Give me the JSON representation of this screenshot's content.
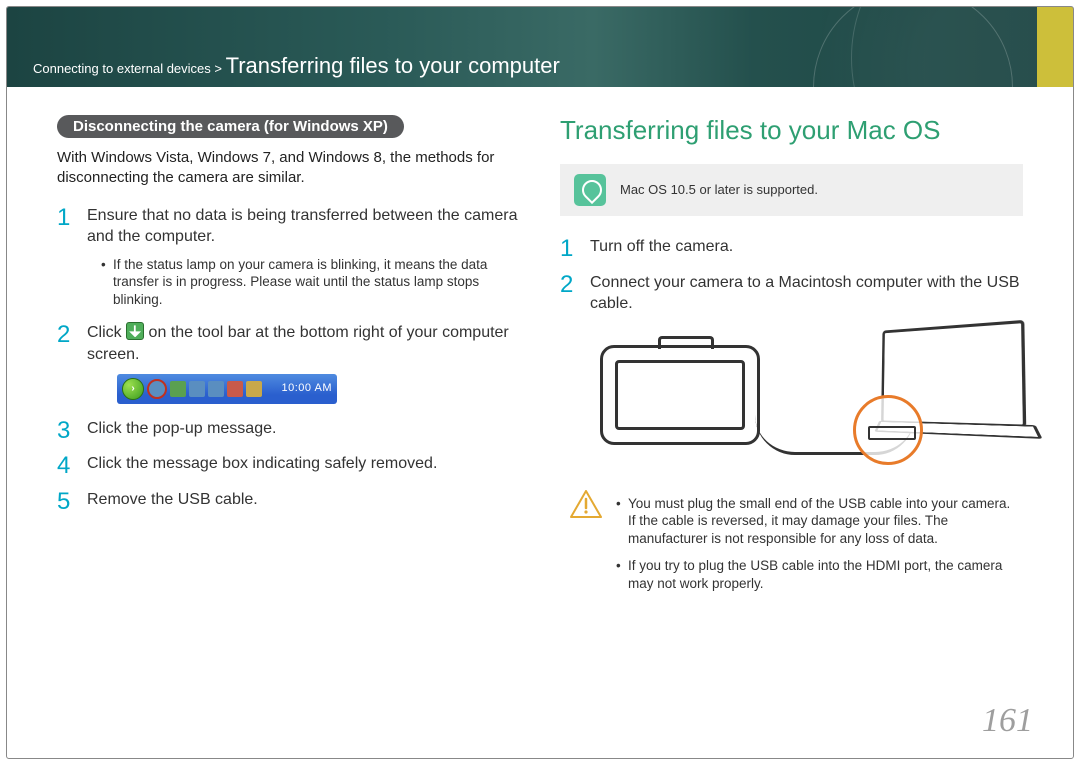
{
  "header": {
    "breadcrumb_prefix": "Connecting to external devices >",
    "breadcrumb_title": "Transferring files to your computer"
  },
  "left": {
    "pill": "Disconnecting the camera (for Windows XP)",
    "intro": "With Windows Vista, Windows 7, and Windows 8, the methods for disconnecting the camera are similar.",
    "steps": [
      {
        "text": "Ensure that no data is being transferred between the camera and the computer.",
        "sub": "If the status lamp on your camera is blinking, it means the data transfer is in progress. Please wait until the status lamp stops blinking."
      },
      {
        "text_before": "Click ",
        "text_after": " on the tool bar at the bottom right of your computer screen.",
        "taskbar_time": "10:00 AM"
      },
      {
        "text": "Click the pop-up message."
      },
      {
        "text": "Click the message box indicating safely removed."
      },
      {
        "text": "Remove the USB cable."
      }
    ]
  },
  "right": {
    "title": "Transferring files to your Mac OS",
    "note": "Mac OS 10.5 or later is supported.",
    "steps": [
      {
        "text": "Turn off the camera."
      },
      {
        "text": "Connect your camera to a Macintosh computer with the USB cable."
      }
    ],
    "caution": [
      "You must plug the small end of the USB cable into your camera. If the cable is reversed, it may damage your files. The manufacturer is not responsible for any loss of data.",
      "If you try to plug the USB cable into the HDMI port, the camera may not work properly."
    ]
  },
  "page_number": "161"
}
